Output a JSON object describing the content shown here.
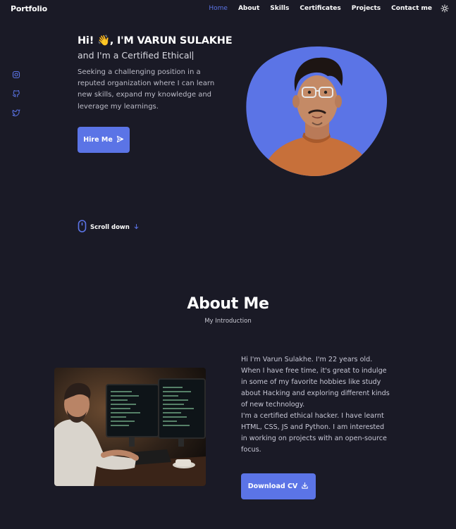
{
  "nav": {
    "brand": "Portfolio",
    "links": [
      "Home",
      "About",
      "Skills",
      "Certificates",
      "Projects",
      "Contact me"
    ],
    "active_color": "#5b74e6"
  },
  "social_icons": [
    "instagram-icon",
    "github-icon",
    "twitter-icon"
  ],
  "hero": {
    "greeting": "Hi! 👋, I'M VARUN SULAKHE",
    "typed_text": "and I'm a Certified Ethical",
    "description": "Seeking a challenging position in a reputed organization where I can learn new skills, expand my knowledge and leverage my learnings.",
    "button_label": "Hire Me",
    "button_icon": "send-icon",
    "accent_color": "#5b74e6"
  },
  "scroll": {
    "label": "Scroll down",
    "icon": "mouse-icon"
  },
  "about": {
    "title": "About Me",
    "subtitle": "My Introduction",
    "paragraph1": "Hi I'm Varun Sulakhe. I'm 22 years old. When I have free time, it's great to indulge in some of my favorite hobbies like study about Hacking and exploring different kinds of new technology.",
    "paragraph2": "I'm a certified ethical hacker. I have learnt HTML, CSS, JS and Python. I am interested in working on projects with an open-source focus.",
    "button_label": "Download CV",
    "button_icon": "download-icon"
  },
  "colors": {
    "background": "#1a1a26",
    "accent": "#5b74e6"
  }
}
